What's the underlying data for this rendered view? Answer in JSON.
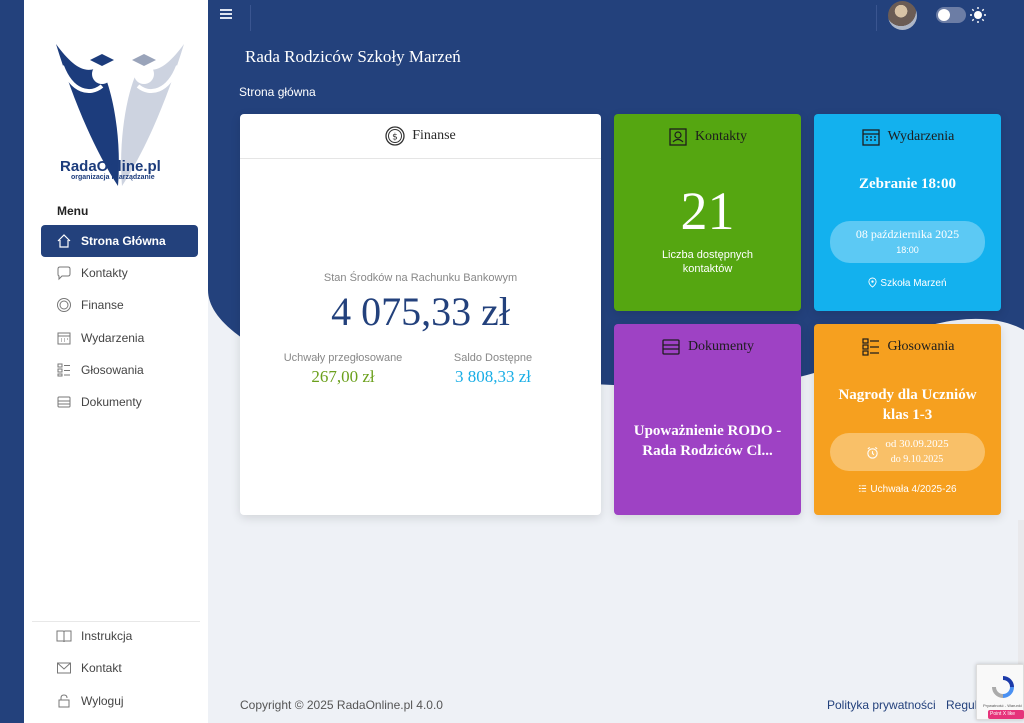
{
  "brand": {
    "name": "RadaOnline.pl",
    "tagline": "organizacja i zarządzanie"
  },
  "sidebar": {
    "heading": "Menu",
    "items": [
      {
        "label": "Strona Główna",
        "icon": "home-icon",
        "active": true
      },
      {
        "label": "Kontakty",
        "icon": "chat-icon",
        "active": false
      },
      {
        "label": "Finanse",
        "icon": "coin-icon",
        "active": false
      },
      {
        "label": "Wydarzenia",
        "icon": "calendar-icon",
        "active": false
      },
      {
        "label": "Głosowania",
        "icon": "checklist-icon",
        "active": false
      },
      {
        "label": "Dokumenty",
        "icon": "archive-icon",
        "active": false
      }
    ],
    "bottom_items": [
      {
        "label": "Instrukcja",
        "icon": "book-icon"
      },
      {
        "label": "Kontakt",
        "icon": "mail-icon"
      },
      {
        "label": "Wyloguj",
        "icon": "lock-icon"
      }
    ]
  },
  "header": {
    "title": "Rada Rodziców Szkoły Marzeń",
    "breadcrumb": "Strona główna"
  },
  "cards": {
    "finanse": {
      "title": "Finanse",
      "balance_label": "Stan Środków na Rachunku Bankowym",
      "balance": "4 075,33 zł",
      "voted_label": "Uchwały przegłosowane",
      "voted_value": "267,00 zł",
      "available_label": "Saldo Dostępne",
      "available_value": "3 808,33 zł"
    },
    "kontakty": {
      "title": "Kontakty",
      "count": "21",
      "count_label": "Liczba dostępnych kontaktów"
    },
    "wydarzenia": {
      "title": "Wydarzenia",
      "event_title": "Zebranie 18:00",
      "date": "08 października 2025",
      "time": "18:00",
      "place": "Szkoła Marzeń"
    },
    "dokumenty": {
      "title": "Dokumenty",
      "doc_title": "Upoważnienie RODO - Rada Rodziców Cl..."
    },
    "glosowania": {
      "title": "Głosowania",
      "vote_title": "Nagrody dla Uczniów klas 1-3",
      "from": "od 30.09.2025",
      "to": "do 9.10.2025",
      "resolution": "Uchwała 4/2025-26"
    }
  },
  "footer": {
    "copyright": "Copyright © 2025 RadaOnline.pl 4.0.0",
    "privacy": "Polityka prywatności",
    "terms": "Regul"
  },
  "widgets": {
    "recaptcha_text": "Prywatność - Warunki",
    "pointx_label": "Point X like"
  },
  "colors": {
    "navy": "#23417c",
    "green": "#55a611",
    "blue": "#13b1ee",
    "purple": "#9e42c4",
    "orange": "#f6a01f"
  }
}
